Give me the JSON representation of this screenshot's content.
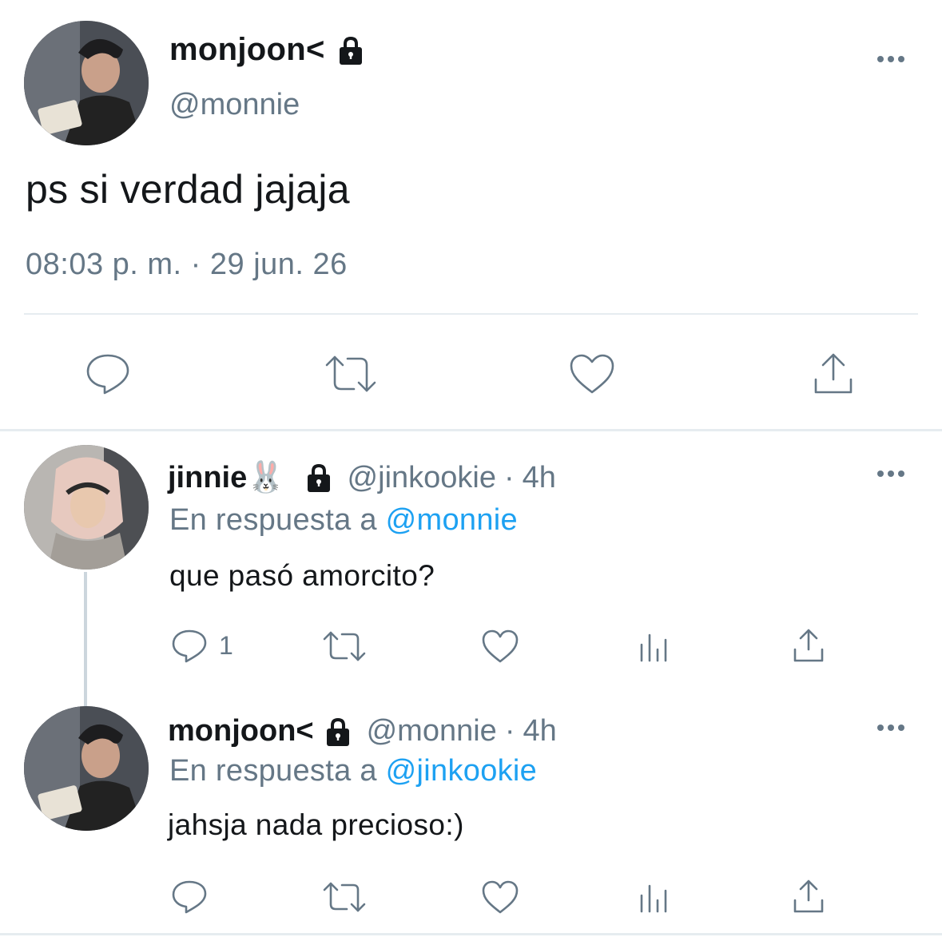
{
  "main_tweet": {
    "display_name": "monjoon<",
    "handle": "@monnie",
    "text": "ps si verdad jajaja",
    "timestamp": "08:03 p. m. · 29 jun. 26",
    "more_icon": "more-dots-icon",
    "lock_icon": "lock-icon"
  },
  "main_actions": {
    "reply_icon": "reply-icon",
    "retweet_icon": "retweet-icon",
    "like_icon": "heart-icon",
    "share_icon": "share-icon"
  },
  "replies": [
    {
      "display_name": "jinnie🐰",
      "handle": "@jinkookie",
      "separator": "·",
      "time": "4h",
      "in_reply_prefix": "En respuesta a",
      "in_reply_to": "@monnie",
      "text": "que pasó amorcito?",
      "reply_count": "1"
    },
    {
      "display_name": "monjoon<",
      "handle": "@monnie",
      "separator": "·",
      "time": "4h",
      "in_reply_prefix": "En respuesta a",
      "in_reply_to": "@jinkookie",
      "text": "jahsja nada precioso:)",
      "reply_count": ""
    }
  ],
  "colors": {
    "text": "#14171a",
    "secondary": "#657786",
    "link": "#1da1f2",
    "divider": "#e6ecf0"
  }
}
